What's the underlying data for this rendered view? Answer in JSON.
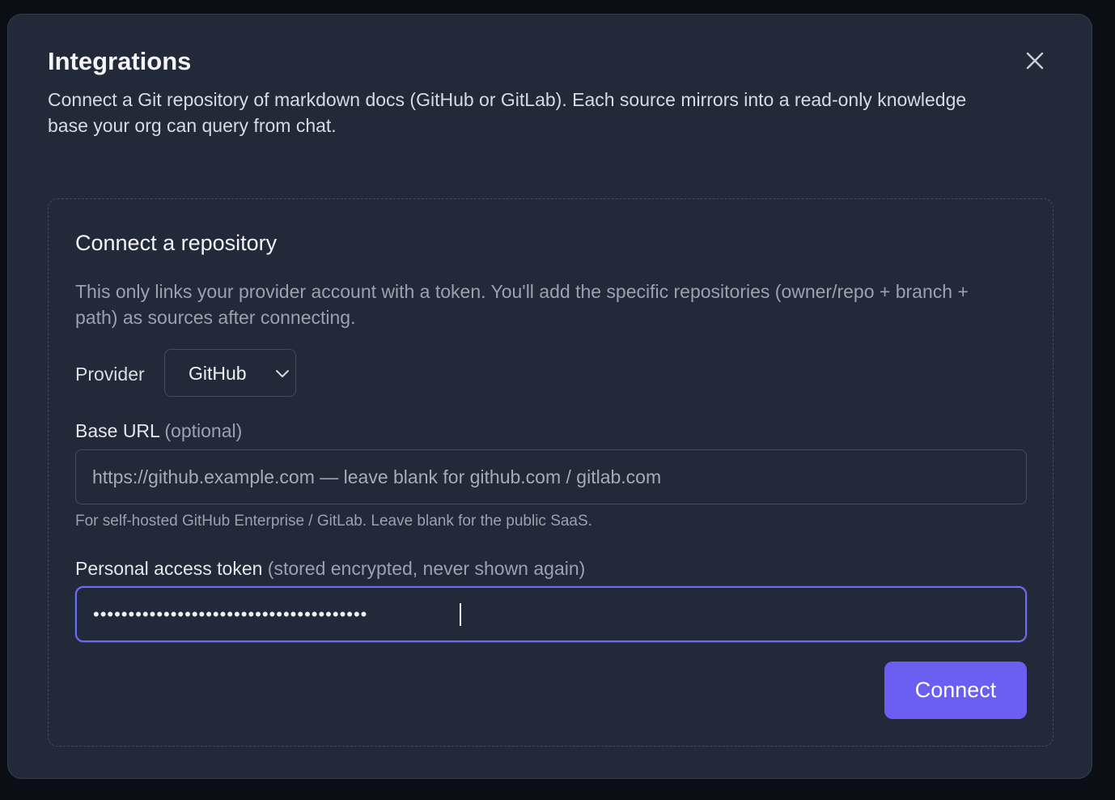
{
  "dialog": {
    "title": "Integrations",
    "description": "Connect a Git repository of markdown docs (GitHub or GitLab). Each source mirrors into a read-only knowledge base your org can query from chat.",
    "close_icon": "close-icon"
  },
  "connect_card": {
    "title": "Connect a repository",
    "description": "This only links your provider account with a token. You'll add the specific repositories (owner/repo + branch + path) as sources after connecting.",
    "provider": {
      "label": "Provider",
      "selected": "GitHub",
      "icon": "chevron-down-icon"
    },
    "base_url": {
      "label": "Base URL",
      "label_note": "(optional)",
      "value": "",
      "placeholder": "https://github.example.com — leave blank for github.com / gitlab.com",
      "hint": "For self-hosted GitHub Enterprise / GitLab. Leave blank for the public SaaS."
    },
    "token": {
      "label": "Personal access token",
      "label_note": "(stored encrypted, never shown again)",
      "value": "ghp_xxxxxxxxxxxxxxxxxxxxxxxxxxxxxxxxxxx"
    },
    "connect_label": "Connect"
  },
  "colors": {
    "background": "#0b0e14",
    "modal": "#222938",
    "accent": "#6a5ef3",
    "focus_ring": "#6b6cf2"
  }
}
